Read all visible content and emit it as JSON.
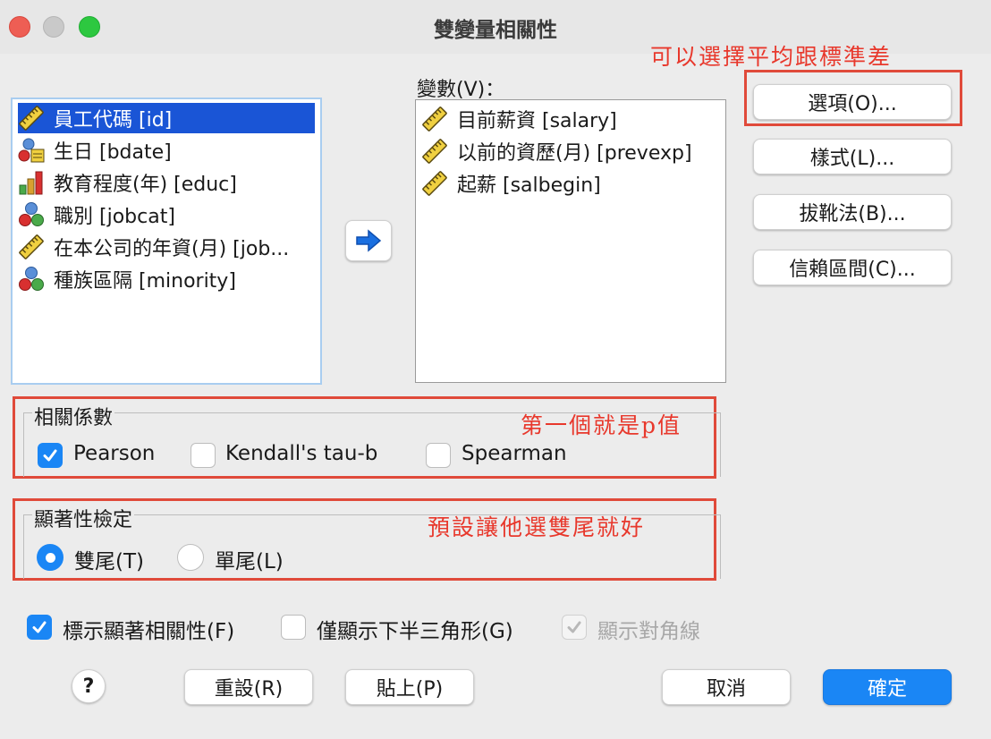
{
  "window": {
    "title": "雙變量相關性",
    "traffic": {
      "close": "#ee5e54",
      "minimize": "#c9c9c9",
      "zoom": "#2dc840"
    }
  },
  "annotations": {
    "options_note": "可以選擇平均跟標準差",
    "coef_note": "第一個就是p值",
    "sig_note": "預設讓他選雙尾就好",
    "color": "#e8382c"
  },
  "source_list": [
    {
      "label": "員工代碼  [id]",
      "icon": "scale-ruler-icon",
      "selected": true
    },
    {
      "label": "生日 [bdate]",
      "icon": "nominal-date-icon",
      "selected": false
    },
    {
      "label": "教育程度(年) [educ]",
      "icon": "ordinal-bars-icon",
      "selected": false
    },
    {
      "label": "職別 [jobcat]",
      "icon": "nominal-balls-icon",
      "selected": false
    },
    {
      "label": "在本公司的年資(月) [job...",
      "icon": "scale-ruler-icon",
      "selected": false
    },
    {
      "label": "種族區隔 [minority]",
      "icon": "nominal-balls-icon",
      "selected": false
    }
  ],
  "variables": {
    "label": "變數(V)：",
    "items": [
      {
        "label": "目前薪資 [salary]",
        "icon": "scale-ruler-icon"
      },
      {
        "label": "以前的資歷(月) [prevexp]",
        "icon": "scale-ruler-icon"
      },
      {
        "label": "起薪 [salbegin]",
        "icon": "scale-ruler-icon"
      }
    ]
  },
  "side_buttons": {
    "options": "選項(O)...",
    "style": "樣式(L)...",
    "bootstrap": "拔靴法(B)...",
    "confidence": "信賴區間(C)..."
  },
  "coefficients": {
    "title": "相關係數",
    "pearson": {
      "label": "Pearson",
      "checked": true
    },
    "kendall": {
      "label": "Kendall's tau-b",
      "checked": false
    },
    "spearman": {
      "label": "Spearman",
      "checked": false
    }
  },
  "significance": {
    "title": "顯著性檢定",
    "two_tailed": {
      "label": "雙尾(T)",
      "selected": true
    },
    "one_tailed": {
      "label": "單尾(L)",
      "selected": false
    }
  },
  "options_row": {
    "flag": {
      "label": "標示顯著相關性(F)",
      "checked": true
    },
    "lower": {
      "label": "僅顯示下半三角形(G)",
      "checked": false
    },
    "diagonal": {
      "label": "顯示對角線",
      "checked": true,
      "disabled": true
    }
  },
  "bottom_buttons": {
    "help": "?",
    "reset": "重設(R)",
    "paste": "貼上(P)",
    "cancel": "取消",
    "ok": "確定"
  },
  "colors": {
    "accent": "#1a86f5",
    "selection": "#1a55d6",
    "highlight_box": "#e04a3a"
  }
}
